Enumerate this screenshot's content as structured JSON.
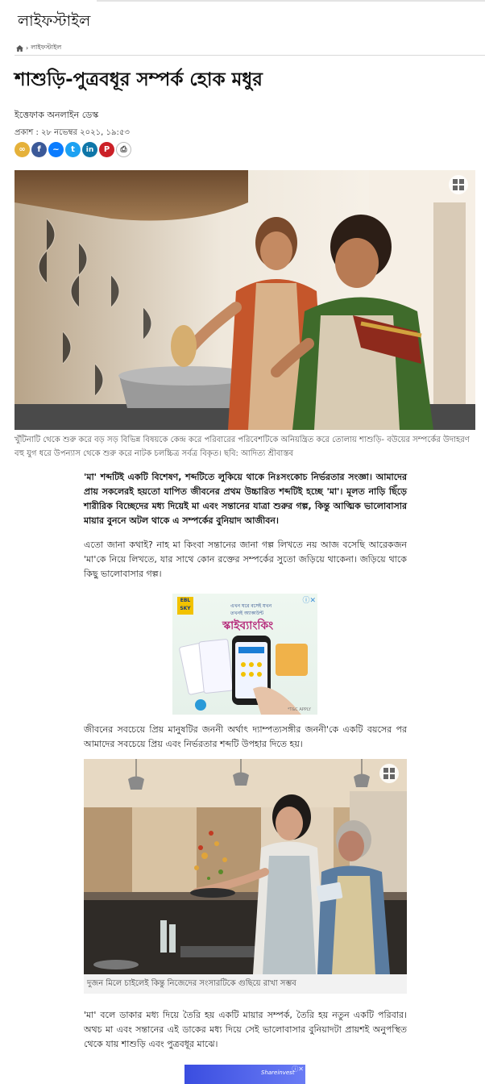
{
  "section": {
    "title": "লাইফস্টাইল",
    "breadcrumb_home_icon": "home-icon",
    "breadcrumb_sep": "›",
    "breadcrumb_item": "লাইফস্টাইল"
  },
  "article": {
    "headline": "শাশুড়ি-পুত্রবধূর সম্পর্ক হোক মধুর",
    "author": "ইত্তেফাক অনলাইন ডেস্ক",
    "published": "প্রকাশ : ২৮ নভেম্বর ২০২১, ১৯:৫৩",
    "share_icons": [
      {
        "name": "link-icon",
        "glyph": "🔗",
        "color": "#e5b13a"
      },
      {
        "name": "facebook-icon",
        "glyph": "f",
        "color": "#3b5998"
      },
      {
        "name": "messenger-icon",
        "glyph": "m",
        "color": "#0a7cff"
      },
      {
        "name": "twitter-icon",
        "glyph": "t",
        "color": "#1da1f2"
      },
      {
        "name": "linkedin-icon",
        "glyph": "in",
        "color": "#0e76a8"
      },
      {
        "name": "pinterest-icon",
        "glyph": "P",
        "color": "#cb2027"
      },
      {
        "name": "print-icon",
        "glyph": "⎙",
        "color": "#777777"
      }
    ],
    "caption1": "খুঁটিনাটি থেকে শুরু করে বড় সড় বিভিন্ন বিষয়কে কেন্দ্র করে পরিবারের পরিবেশটিকে অনিয়ন্ত্রিত করে তোলায় শাশুড়ি- বউয়ের সম্পর্কের উদাহরণ বহু যুগ ধরে উপন্যাস থেকে শুরু করে নাটক চলচ্চিত্র সর্বত্র বিকৃত। ছবি: আদিত্য শ্রীবাস্তব",
    "lead": "'মা' শব্দটিই একটি বিশেষণ, শব্দটিতে লুকিয়ে থাকে নিঃসংকোচ নির্ভরতার সংজ্ঞা। আমাদের প্রায় সকলেরই হয়তো যাপিত জীবনের প্রথম উচ্চারিত শব্দটিই হচ্ছে 'মা'। মূলত নাড়ি ছিঁড়ে শারীরিক বিচ্ছেদের মধ্য দিয়েই মা এবং সন্তানের যাত্রা শুরুর গল্প, কিন্তু আত্মিক ভালোবাসার মায়ার বুননে অটল থাকে এ সম্পর্কের বুনিয়াদ আজীবন।",
    "para1": "এতো জানা কথাই? নাহ মা কিংবা সন্তানের জানা গল্প লিখতে নয় আজ বসেছি আরেকজন 'মা'কে নিয়ে লিখতে, যার সাথে কোন রক্তের সম্পর্কের সুতো জড়িয়ে থাকেনা। জড়িয়ে থাকে কিছু ভালোবাসার গল্প।",
    "para2": "জীবনের সবচেয়ে প্রিয় মানুষটির জননী অর্থাৎ দ্যাম্পত্যসঙ্গীর জননী'কে একটি বয়সের পর আমাদের সবচেয়ে প্রিয় এবং নির্ভরতার শব্দটি উপহার দিতে হয়।",
    "caption2": "দুজন মিলে চাইলেই কিন্তু নিজেদের সংসারটিকে গুছিয়ে রাখা সম্ভব",
    "para3": "'মা' বলে ডাকার মধ্য দিয়ে তৈরি হয় একটি মায়ার সম্পর্ক, তৈরি হয় নতুন একটি পরিবার। অথচ মা এবং সন্তানের এই ডাকের মধ্য দিয়ে সেই ভালোবাসার বুনিয়াদটা প্রায়শই অনুপস্থিত থেকে যায় শাশুড়ি এবং পুত্রবধূর মাঝে।"
  },
  "ad1": {
    "brand_top": "EBL",
    "brand_bottom": "SKY",
    "small_line1": "এখন ঘরে বসেই যখন",
    "small_line2": "তখনই অ্যাকাউন্ট",
    "headline": "স্কাইব্যাংকিং",
    "footnote": "*T&C APPLY",
    "badge": "ⓘ✕"
  },
  "ad2": {
    "label": "Shareinvest",
    "badge": "ⓘ✕"
  }
}
